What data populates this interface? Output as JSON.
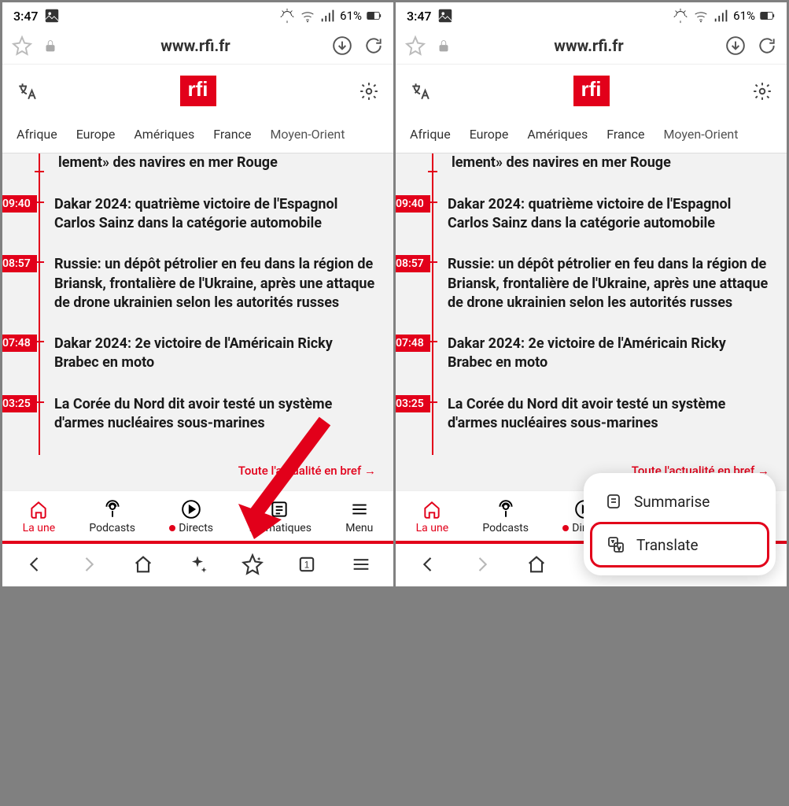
{
  "status": {
    "time": "3:47",
    "battery_pct": "61%"
  },
  "address_bar": {
    "url": "www.rfi.fr"
  },
  "logo": "rfi",
  "nav": [
    "Afrique",
    "Europe",
    "Amériques",
    "France",
    "Moyen-Orient"
  ],
  "feed": {
    "partial": "lement» des navires en mer Rouge",
    "items": [
      {
        "time": "09:40",
        "headline": "Dakar 2024: quatrième victoire de l'Espagnol Carlos Sainz dans la catégorie automobile"
      },
      {
        "time": "08:57",
        "headline": "Russie: un dépôt pétrolier en feu dans la région de Briansk, frontalière de l'Ukraine, après une attaque de drone ukrainien selon les autorités russes"
      },
      {
        "time": "07:48",
        "headline": "Dakar 2024: 2e victoire de l'Américain Ricky Brabec en moto"
      },
      {
        "time": "03:25",
        "headline": "La Corée du Nord dit avoir testé un système d'armes nucléaires sous-marines"
      }
    ],
    "more": "Toute l'actualité en bref  →"
  },
  "site_nav": [
    {
      "label": "La une",
      "icon": "home",
      "active": true
    },
    {
      "label": "Podcasts",
      "icon": "podcast",
      "active": false
    },
    {
      "label": "Directs",
      "icon": "play",
      "active": false,
      "dot": true
    },
    {
      "label": "Thématiques",
      "icon": "news",
      "active": false
    },
    {
      "label": "Menu",
      "icon": "menu",
      "active": false
    }
  ],
  "popup": {
    "summarise": "Summarise",
    "translate": "Translate"
  }
}
